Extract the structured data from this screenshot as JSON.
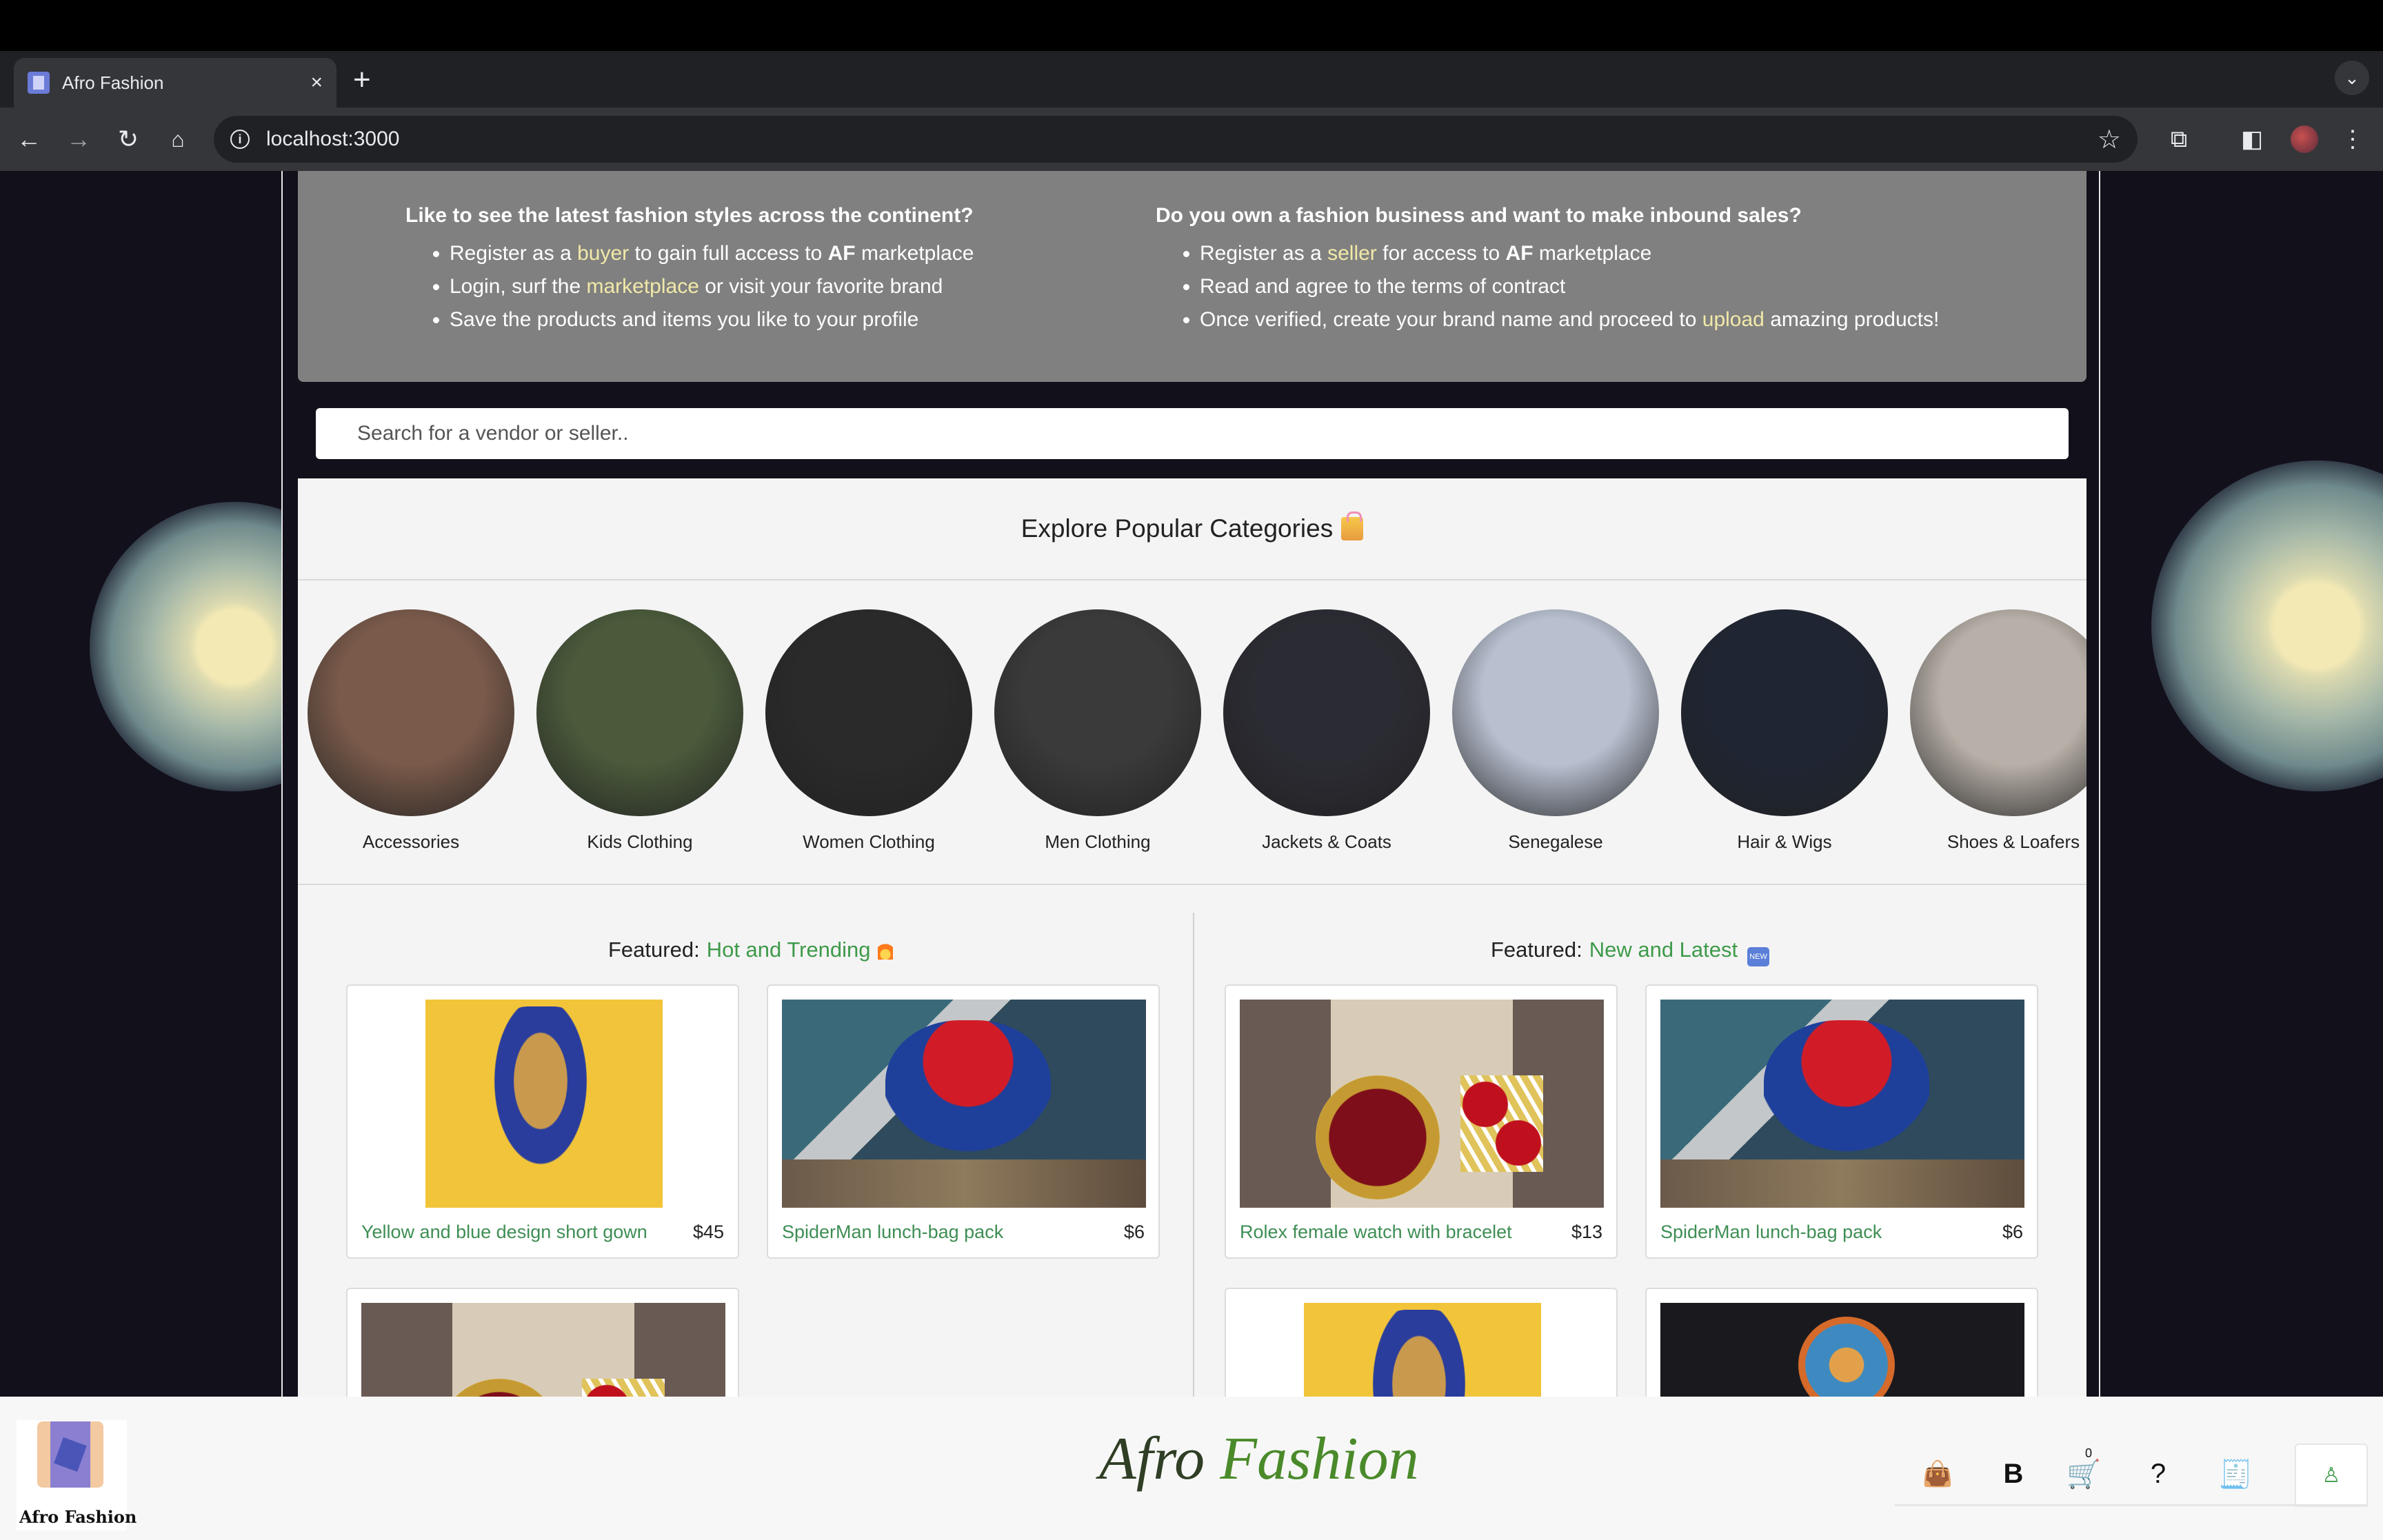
{
  "browser": {
    "tab_title": "Afro Fashion",
    "url": "localhost:3000"
  },
  "info": {
    "left": {
      "heading": "Like to see the latest fashion styles across the continent?",
      "items": [
        {
          "pre": "Register as a ",
          "hl": "buyer",
          "mid": " to gain full access to ",
          "bold": "AF",
          "post": " marketplace"
        },
        {
          "pre": "Login, surf the ",
          "hl": "marketplace",
          "post": " or visit your favorite brand"
        },
        {
          "text": "Save the products and items you like to your profile"
        }
      ]
    },
    "right": {
      "heading": "Do you own a fashion business and want to make inbound sales?",
      "items": [
        {
          "pre": "Register as a ",
          "hl": "seller",
          "mid": " for access to ",
          "bold": "AF",
          "post": " marketplace"
        },
        {
          "text": "Read and agree to the terms of contract"
        },
        {
          "pre": "Once verified, create your brand name and proceed to ",
          "hl": "upload",
          "post": " amazing products!"
        }
      ]
    }
  },
  "search": {
    "placeholder": "Search for a vendor or seller.."
  },
  "categories": {
    "title": "Explore Popular Categories",
    "items": [
      {
        "label": "Accessories",
        "color": "#7a5a4a"
      },
      {
        "label": "Kids Clothing",
        "color": "#4a5a3a"
      },
      {
        "label": "Women Clothing",
        "color": "#2a2a2a"
      },
      {
        "label": "Men Clothing",
        "color": "#3a3a3a"
      },
      {
        "label": "Jackets & Coats",
        "color": "#2b2b33"
      },
      {
        "label": "Senegalese",
        "color": "#b8c0d0"
      },
      {
        "label": "Hair & Wigs",
        "color": "#1f2533"
      },
      {
        "label": "Shoes & Loafers",
        "color": "#b8b0a8"
      }
    ]
  },
  "featured": {
    "prefix": "Featured:",
    "hot": {
      "label": "Hot and Trending",
      "products": [
        {
          "name": "Yellow and blue design short gown",
          "price": "$45"
        },
        {
          "name": "SpiderMan lunch-bag pack",
          "price": "$6"
        }
      ]
    },
    "new": {
      "label": "New and Latest",
      "badge": "NEW",
      "products": [
        {
          "name": "Rolex female watch with bracelet",
          "price": "$13"
        },
        {
          "name": "SpiderMan lunch-bag pack",
          "price": "$6"
        }
      ]
    }
  },
  "footer": {
    "logo_text": "Afro Fashion",
    "brand_part1": "Afro ",
    "brand_part2": "Fashion",
    "cart_count": "0",
    "icons": [
      "shopping-bag-icon",
      "brand-b-icon",
      "cart-icon",
      "help-icon",
      "receipt-icon",
      "user-icon"
    ]
  },
  "colors": {
    "accent_green": "#3e9a4a",
    "highlight_yellow": "#f1e9a8",
    "info_panel": "#808080"
  }
}
